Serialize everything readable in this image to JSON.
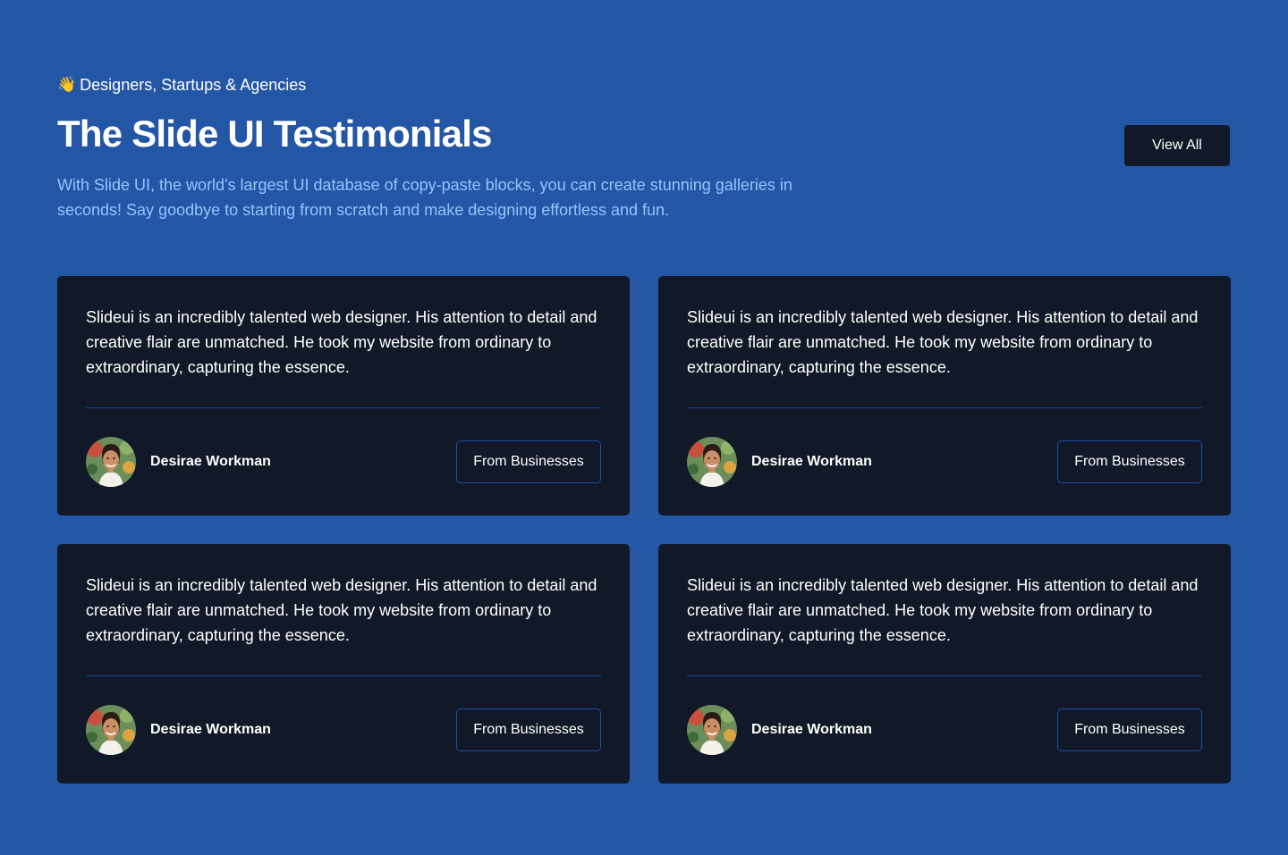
{
  "header": {
    "eyebrow_icon": "👋",
    "eyebrow": "Designers, Startups & Agencies",
    "title": "The Slide UI Testimonials",
    "description": "With Slide UI, the world's largest UI database of copy-paste blocks, you can create stunning galleries in seconds! Say goodbye to starting from scratch and make designing effortless and fun.",
    "view_all_label": "View All"
  },
  "colors": {
    "background": "#2356a5",
    "card": "#111827",
    "accent_text": "#93c5fd",
    "divider": "#1d4ed8"
  },
  "testimonials": [
    {
      "quote": "Slideui is an incredibly talented web designer. His attention to detail and creative flair are unmatched. He took my website from ordinary to extraordinary, capturing the essence.",
      "name": "Desirae Workman",
      "tag": "From Businesses"
    },
    {
      "quote": "Slideui is an incredibly talented web designer. His attention to detail and creative flair are unmatched. He took my website from ordinary to extraordinary, capturing the essence.",
      "name": "Desirae Workman",
      "tag": "From Businesses"
    },
    {
      "quote": "Slideui is an incredibly talented web designer. His attention to detail and creative flair are unmatched. He took my website from ordinary to extraordinary, capturing the essence.",
      "name": "Desirae Workman",
      "tag": "From Businesses"
    },
    {
      "quote": "Slideui is an incredibly talented web designer. His attention to detail and creative flair are unmatched. He took my website from ordinary to extraordinary, capturing the essence.",
      "name": "Desirae Workman",
      "tag": "From Businesses"
    }
  ]
}
